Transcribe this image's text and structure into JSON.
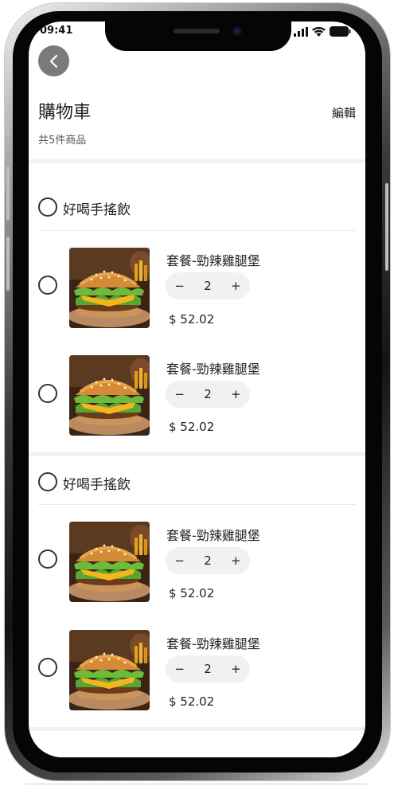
{
  "status_bar": {
    "time": "09:41"
  },
  "header": {
    "title": "購物車",
    "edit_label": "編輯",
    "item_count": "共5件商品"
  },
  "shops": [
    {
      "name": "好喝手搖飲",
      "items": [
        {
          "name": "套餐-勁辣雞腿堡",
          "quantity": "2",
          "minus": "−",
          "plus": "+",
          "price": "$ 52.02"
        },
        {
          "name": "套餐-勁辣雞腿堡",
          "quantity": "2",
          "minus": "−",
          "plus": "+",
          "price": "$ 52.02"
        }
      ]
    },
    {
      "name": "好喝手搖飲",
      "items": [
        {
          "name": "套餐-勁辣雞腿堡",
          "quantity": "2",
          "minus": "−",
          "plus": "+",
          "price": "$ 52.02"
        },
        {
          "name": "套餐-勁辣雞腿堡",
          "quantity": "2",
          "minus": "−",
          "plus": "+",
          "price": "$ 52.02"
        }
      ]
    }
  ],
  "icons": {
    "back": "chevron-left-icon",
    "signal": "signal-icon",
    "wifi": "wifi-icon",
    "battery": "battery-icon",
    "product": "burger-image"
  },
  "colors": {
    "back_button_bg": "#7a7a7a",
    "stepper_bg": "#f1f1f1",
    "text": "#222222"
  }
}
